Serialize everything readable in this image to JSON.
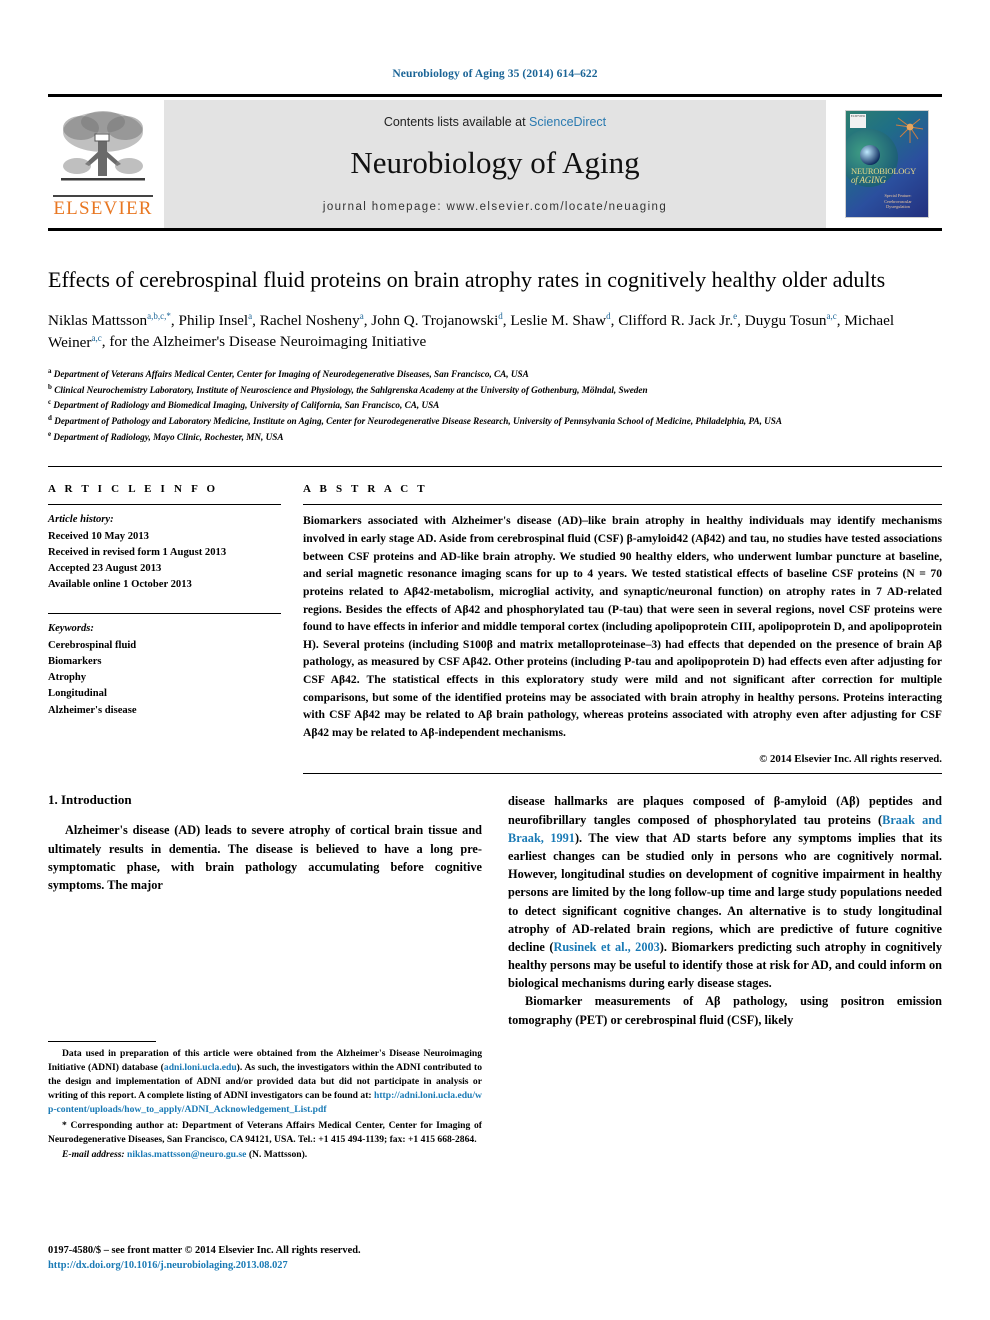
{
  "running_head": "Neurobiology of Aging 35 (2014) 614–622",
  "masthead": {
    "contents_prefix": "Contents lists available at ",
    "contents_link": "ScienceDirect",
    "journal_title": "Neurobiology of Aging",
    "homepage": "journal homepage: www.elsevier.com/locate/neuaging",
    "publisher_logo_text": "ELSEVIER",
    "cover": {
      "title_line1": "NEUROBIOLOGY",
      "title_line2": "of AGING",
      "subtitle_line1": "Special Feature:",
      "subtitle_line2": "Cerebrovascular Dysregulation",
      "badge": "ELSEVIER"
    }
  },
  "article": {
    "title": "Effects of cerebrospinal fluid proteins on brain atrophy rates in cognitively healthy older adults",
    "authors": [
      {
        "name": "Niklas Mattsson",
        "marks": "a,b,c,",
        "star": true
      },
      {
        "name": "Philip Insel",
        "marks": "a"
      },
      {
        "name": "Rachel Nosheny",
        "marks": "a"
      },
      {
        "name": "John Q. Trojanowski",
        "marks": "d"
      },
      {
        "name": "Leslie M. Shaw",
        "marks": "d"
      },
      {
        "name": "Clifford R. Jack Jr.",
        "marks": "e"
      },
      {
        "name": "Duygu Tosun",
        "marks": "a,c"
      },
      {
        "name": "Michael Weiner",
        "marks": "a,c"
      }
    ],
    "authors_tail": ", for the Alzheimer's Disease Neuroimaging Initiative",
    "affiliations": [
      {
        "mark": "a",
        "text": "Department of Veterans Affairs Medical Center, Center for Imaging of Neurodegenerative Diseases, San Francisco, CA, USA"
      },
      {
        "mark": "b",
        "text": "Clinical Neurochemistry Laboratory, Institute of Neuroscience and Physiology, the Sahlgrenska Academy at the University of Gothenburg, Mölndal, Sweden"
      },
      {
        "mark": "c",
        "text": "Department of Radiology and Biomedical Imaging, University of California, San Francisco, CA, USA"
      },
      {
        "mark": "d",
        "text": "Department of Pathology and Laboratory Medicine, Institute on Aging, Center for Neurodegenerative Disease Research, University of Pennsylvania School of Medicine, Philadelphia, PA, USA"
      },
      {
        "mark": "e",
        "text": "Department of Radiology, Mayo Clinic, Rochester, MN, USA"
      }
    ]
  },
  "article_info": {
    "heading": "A R T I C L E  I N F O",
    "history_label": "Article history:",
    "history": [
      "Received 10 May 2013",
      "Received in revised form 1 August 2013",
      "Accepted 23 August 2013",
      "Available online 1 October 2013"
    ],
    "keywords_label": "Keywords:",
    "keywords": [
      "Cerebrospinal fluid",
      "Biomarkers",
      "Atrophy",
      "Longitudinal",
      "Alzheimer's disease"
    ]
  },
  "abstract": {
    "heading": "A B S T R A C T",
    "text": "Biomarkers associated with Alzheimer's disease (AD)–like brain atrophy in healthy individuals may identify mechanisms involved in early stage AD. Aside from cerebrospinal fluid (CSF) β-amyloid42 (Aβ42) and tau, no studies have tested associations between CSF proteins and AD-like brain atrophy. We studied 90 healthy elders, who underwent lumbar puncture at baseline, and serial magnetic resonance imaging scans for up to 4 years. We tested statistical effects of baseline CSF proteins (N = 70 proteins related to Aβ42-metabolism, microglial activity, and synaptic/neuronal function) on atrophy rates in 7 AD-related regions. Besides the effects of Aβ42 and phosphorylated tau (P-tau) that were seen in several regions, novel CSF proteins were found to have effects in inferior and middle temporal cortex (including apolipoprotein CIII, apolipoprotein D, and apolipoprotein H). Several proteins (including S100β and matrix metalloproteinase–3) had effects that depended on the presence of brain Aβ pathology, as measured by CSF Aβ42. Other proteins (including P-tau and apolipoprotein D) had effects even after adjusting for CSF Aβ42. The statistical effects in this exploratory study were mild and not significant after correction for multiple comparisons, but some of the identified proteins may be associated with brain atrophy in healthy persons. Proteins interacting with CSF Aβ42 may be related to Aβ brain pathology, whereas proteins associated with atrophy even after adjusting for CSF Aβ42 may be related to Aβ-independent mechanisms.",
    "copyright": "© 2014 Elsevier Inc. All rights reserved."
  },
  "introduction": {
    "heading": "1. Introduction",
    "left_para": "Alzheimer's disease (AD) leads to severe atrophy of cortical brain tissue and ultimately results in dementia. The disease is believed to have a long pre-symptomatic phase, with brain pathology accumulating before cognitive symptoms. The major",
    "right_p1_a": "disease hallmarks are plaques composed of β-amyloid (Aβ) peptides and neurofibrillary tangles composed of phosphorylated tau proteins (",
    "right_p1_ref1": "Braak and Braak, 1991",
    "right_p1_b": "). The view that AD starts before any symptoms implies that its earliest changes can be studied only in persons who are cognitively normal. However, longitudinal studies on development of cognitive impairment in healthy persons are limited by the long follow-up time and large study populations needed to detect significant cognitive changes. An alternative is to study longitudinal atrophy of AD-related brain regions, which are predictive of future cognitive decline (",
    "right_p1_ref2": "Rusinek et al., 2003",
    "right_p1_c": "). Biomarkers predicting such atrophy in cognitively healthy persons may be useful to identify those at risk for AD, and could inform on biological mechanisms during early disease stages.",
    "right_p2": "Biomarker measurements of Aβ pathology, using positron emission tomography (PET) or cerebrospinal fluid (CSF), likely"
  },
  "footnotes": {
    "data_note_a": "Data used in preparation of this article were obtained from the Alzheimer's Disease Neuroimaging Initiative (ADNI) database (",
    "data_note_link1": "adni.loni.ucla.edu",
    "data_note_b": "). As such, the investigators within the ADNI contributed to the design and implementation of ADNI and/or provided data but did not participate in analysis or writing of this report. A complete listing of ADNI investigators can be found at: ",
    "data_note_link2": "http://adni.loni.ucla.edu/wp-content/uploads/how_to_apply/ADNI_Acknowledgement_List.pdf",
    "corresponding": "* Corresponding author at: Department of Veterans Affairs Medical Center, Center for Imaging of Neurodegenerative Diseases, San Francisco, CA 94121, USA. Tel.: +1 415 494-1139; fax: +1 415 668-2864.",
    "email_label": "E-mail address:",
    "email_link": "niklas.mattsson@neuro.gu.se",
    "email_tail": " (N. Mattsson)."
  },
  "footer": {
    "issn_line": "0197-4580/$ – see front matter © 2014 Elsevier Inc. All rights reserved.",
    "doi_link": "http://dx.doi.org/10.1016/j.neurobiolaging.2013.08.027"
  },
  "colors": {
    "link_blue": "#1a7ab5",
    "header_blue": "#1a6496",
    "elsevier_orange": "#E87722",
    "masthead_grey": "#e3e3e3"
  }
}
